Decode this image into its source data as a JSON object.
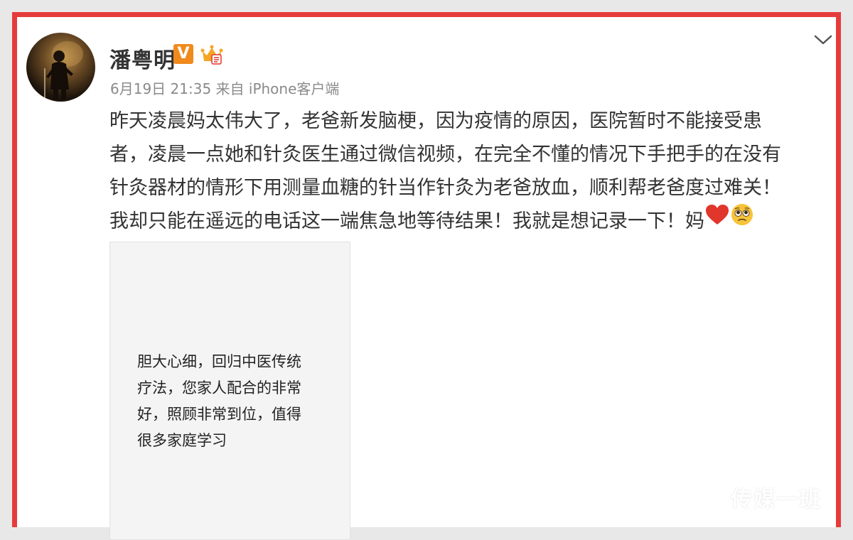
{
  "post": {
    "username": "潘粤明",
    "verified_badge": "V",
    "member_badge_icon": "crown-icon",
    "timestamp": "6月19日 21:35",
    "source": "来自 iPhone客户端",
    "menu_icon": "chevron-down-icon",
    "content_lines": [
      "昨天凌晨妈太伟大了，老爸新发脑梗，因为疫情的原因，医院暂时不能接受患",
      "者，凌晨一点她和针灸医生通过微信视频，在完全不懂的情况下手把手的在没有",
      "针灸器材的情形下用测量血糖的针当作针灸为老爸放血，顺利帮老爸度过难关！",
      "我却只能在遥远的电话这一端焦急地等待结果！我就是想记录一下！妈"
    ],
    "content_emojis": [
      "heart-emoji",
      "pleading-face-emoji"
    ],
    "image": {
      "text_lines": [
        "胆大心细，回归中医传统",
        "疗法，您家人配合的非常",
        "好，照顾非常到位，值得",
        "很多家庭学习"
      ]
    }
  },
  "watermark": "传媒一班",
  "colors": {
    "frame_border": "#e53b3b",
    "badge_orange": "#f08a1d",
    "text_main": "#333333",
    "text_meta": "#8a8a8a",
    "heart": "#e0362c",
    "emoji_face": "#f6c33a"
  }
}
